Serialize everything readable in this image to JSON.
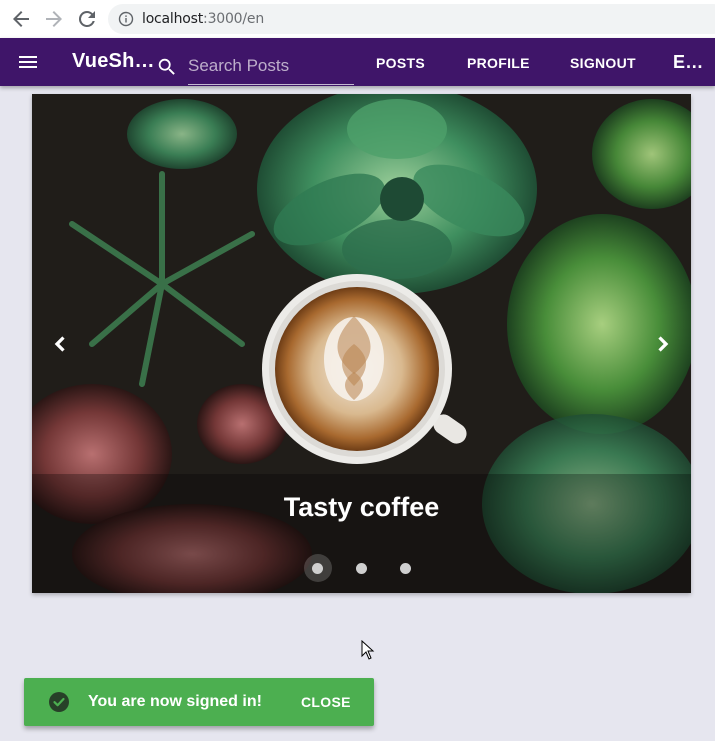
{
  "browser": {
    "url_host": "localhost",
    "url_path": ":3000/en",
    "icons": [
      "back-arrow-icon",
      "forward-arrow-icon",
      "reload-icon",
      "info-icon"
    ]
  },
  "appbar": {
    "brand": "VueSh…",
    "search_placeholder": "Search Posts",
    "links": {
      "posts": "POSTS",
      "profile": "PROFILE",
      "signout": "SIGNOUT",
      "language": "E…"
    },
    "color": "#3f1569"
  },
  "carousel": {
    "caption": "Tasty coffee",
    "slide_count": 3,
    "active_slide": 1,
    "icons": [
      "chevron-left-icon",
      "chevron-right-icon"
    ]
  },
  "snackbar": {
    "message": "You are now signed in!",
    "close_label": "CLOSE",
    "color": "#4caf50",
    "icon": "check-circle-icon"
  }
}
